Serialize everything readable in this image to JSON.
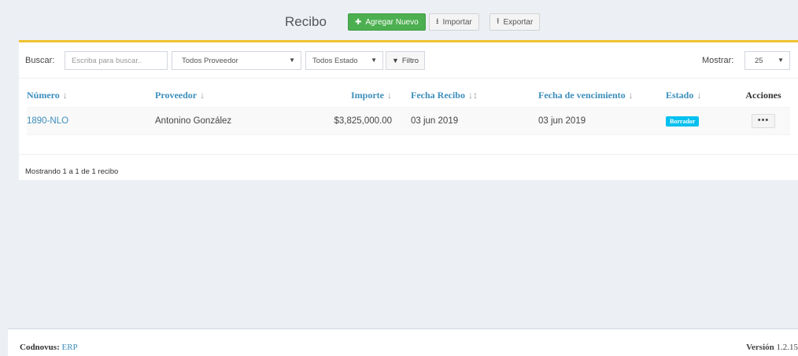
{
  "header": {
    "title": "Recibo",
    "add_label": "Agregar Nuevo",
    "import_label": "Importar",
    "export_label": "Exportar"
  },
  "filters": {
    "search_label": "Buscar:",
    "search_placeholder": "Escriba para buscar..",
    "provider_select": "Todos Proveedor",
    "status_select": "Todos Estado",
    "filter_button": "Filtro",
    "show_label": "Mostrar:",
    "show_value": "25"
  },
  "table": {
    "columns": [
      "Número",
      "Proveedor",
      "Importe",
      "Fecha Recibo",
      "Fecha de vencimiento",
      "Estado",
      "Acciones"
    ],
    "rows": [
      {
        "numero": "1890-NLO",
        "proveedor": "Antonino González",
        "importe": "$3,825,000.00",
        "fecha_recibo": "03 jun 2019",
        "fecha_vencimiento": "03 jun 2019",
        "estado": "Borrador",
        "acciones": "•••"
      }
    ]
  },
  "pagination": {
    "summary": "Mostrando 1 a 1 de 1 recibo"
  },
  "footer": {
    "brand": "Codnovus:",
    "product": "ERP",
    "version_label": "Versión",
    "version": "1.2.15"
  },
  "colors": {
    "accent": "#3c8dbc",
    "add_button": "#4caf50",
    "badge_draft": "#00c0ef",
    "panel_border": "#f0c230"
  }
}
